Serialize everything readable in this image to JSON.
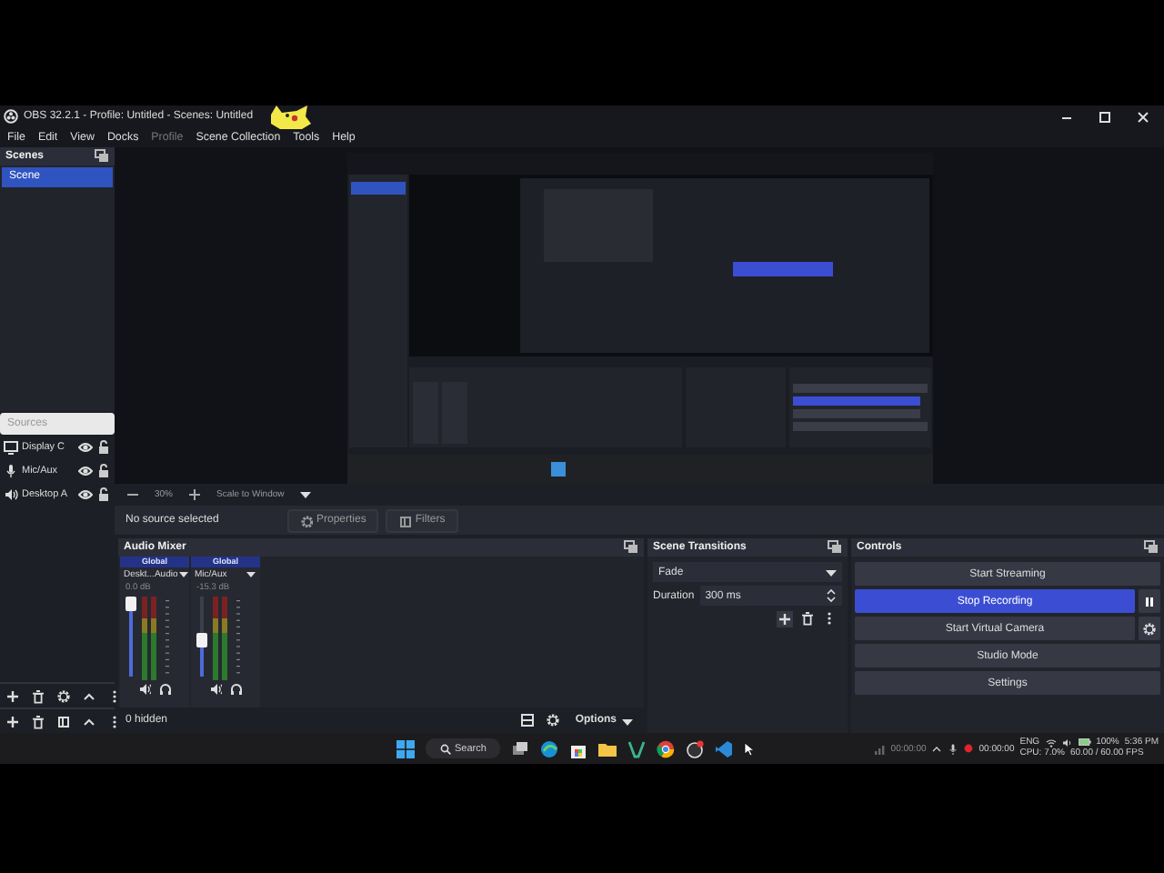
{
  "window": {
    "title": "OBS 32.2.1 - Profile: Untitled - Scenes: Untitled"
  },
  "menu": [
    {
      "label": "File",
      "disabled": false
    },
    {
      "label": "Edit",
      "disabled": false
    },
    {
      "label": "View",
      "disabled": false
    },
    {
      "label": "Docks",
      "disabled": false
    },
    {
      "label": "Profile",
      "disabled": true
    },
    {
      "label": "Scene Collection",
      "disabled": false
    },
    {
      "label": "Tools",
      "disabled": false
    },
    {
      "label": "Help",
      "disabled": false
    }
  ],
  "scenes": {
    "title": "Scenes",
    "items": [
      {
        "label": "Scene",
        "selected": true
      }
    ]
  },
  "sources": {
    "title": "Sources",
    "items": [
      {
        "kind": "display",
        "label": "Display C",
        "visible": true
      },
      {
        "kind": "mic",
        "label": "Mic/Aux",
        "visible": true
      },
      {
        "kind": "speaker",
        "label": "Desktop A",
        "visible": true
      }
    ]
  },
  "preview": {
    "zoom": "30%",
    "scale_mode": "Scale to Window"
  },
  "source_bar": {
    "status": "No source selected",
    "properties": "Properties",
    "filters": "Filters"
  },
  "audio_mixer": {
    "title": "Audio Mixer",
    "channels": [
      {
        "mode": "Global",
        "name": "Deskt...Audio",
        "reading": "0.0 dB",
        "level": 1.0
      },
      {
        "mode": "Global",
        "name": "Mic/Aux",
        "reading": "-15.3 dB",
        "level": 0.45
      }
    ],
    "hidden": "0 hidden",
    "options": "Options"
  },
  "scene_transitions": {
    "title": "Scene Transitions",
    "transition": "Fade",
    "duration_label": "Duration",
    "duration": "300 ms"
  },
  "controls": {
    "title": "Controls",
    "buttons": [
      {
        "label": "Start Streaming",
        "active": false,
        "kind": "plain"
      },
      {
        "label": "Stop Recording",
        "active": true,
        "kind": "pause"
      },
      {
        "label": "Start Virtual Camera",
        "active": false,
        "kind": "settings"
      },
      {
        "label": "Studio Mode",
        "active": false,
        "kind": "plain"
      },
      {
        "label": "Settings",
        "active": false,
        "kind": "plain"
      }
    ]
  },
  "taskbar": {
    "search": "Search"
  },
  "status_bar": {
    "stream_time": "00:00:00",
    "recording": true,
    "record_time": "00:00:00",
    "cpu": "CPU: 7.0%",
    "fps": "60.00 / 60.00 FPS"
  },
  "tray": {
    "language": "ENG",
    "battery": "100%",
    "time": "5:36 PM"
  }
}
